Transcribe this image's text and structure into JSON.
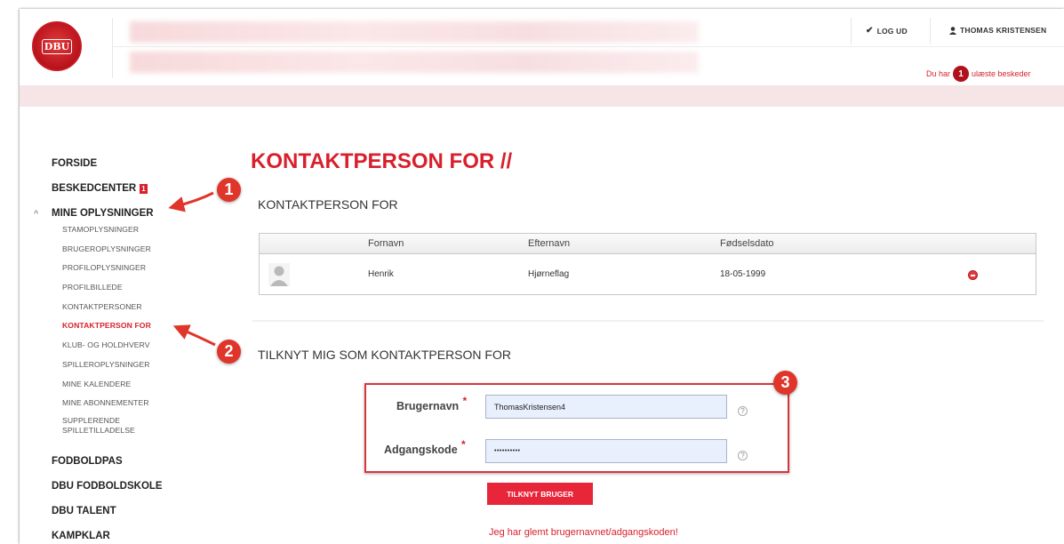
{
  "header": {
    "logo_text": "DBU",
    "logout_label": "LOG UD",
    "user_name": "THOMAS KRISTENSEN",
    "message_prefix": "Du har",
    "message_count": "1",
    "message_suffix": "ulæste beskeder"
  },
  "sidebar": {
    "main_items": [
      {
        "label": "FORSIDE"
      },
      {
        "label": "BESKEDCENTER",
        "badge": "1"
      },
      {
        "label": "MINE OPLYSNINGER"
      }
    ],
    "sub_items": [
      {
        "label": "STAMOPLYSNINGER"
      },
      {
        "label": "BRUGEROPLYSNINGER"
      },
      {
        "label": "PROFILOPLYSNINGER"
      },
      {
        "label": "PROFILBILLEDE"
      },
      {
        "label": "KONTAKTPERSONER"
      },
      {
        "label": "KONTAKTPERSON FOR",
        "active": true
      },
      {
        "label": "KLUB- OG HOLDHVERV"
      },
      {
        "label": "SPILLEROPLYSNINGER"
      },
      {
        "label": "MINE KALENDERE"
      },
      {
        "label": "MINE ABONNEMENTER"
      },
      {
        "label": "SUPPLERENDE SPILLETILLADELSE"
      }
    ],
    "bottom_items": [
      {
        "label": "FODBOLDPAS"
      },
      {
        "label": "DBU FODBOLDSKOLE"
      },
      {
        "label": "DBU TALENT"
      },
      {
        "label": "KAMPKLAR"
      }
    ]
  },
  "main": {
    "page_title": "KONTAKTPERSON FOR //",
    "section1_title": "KONTAKTPERSON FOR",
    "table": {
      "headers": [
        "Fornavn",
        "Efternavn",
        "Fødselsdato"
      ],
      "rows": [
        {
          "fornavn": "Henrik",
          "efternavn": "Hjørneflag",
          "foedselsdato": "18-05-1999"
        }
      ]
    },
    "section2_title": "TILKNYT MIG SOM KONTAKTPERSON FOR",
    "form": {
      "username_label": "Brugernavn",
      "username_value": "ThomasKristensen4",
      "password_label": "Adgangskode",
      "password_value": "••••••••••",
      "required_marker": "*",
      "help_glyph": "?",
      "submit_label": "TILKNYT BRUGER",
      "forgot_link": "Jeg har glemt brugernavnet/adgangskoden!"
    }
  },
  "annotations": [
    "1",
    "2",
    "3"
  ],
  "colors": {
    "brand_red": "#d81f2b",
    "annotation_red": "#e0352b",
    "input_bg": "#e8f0fe"
  }
}
